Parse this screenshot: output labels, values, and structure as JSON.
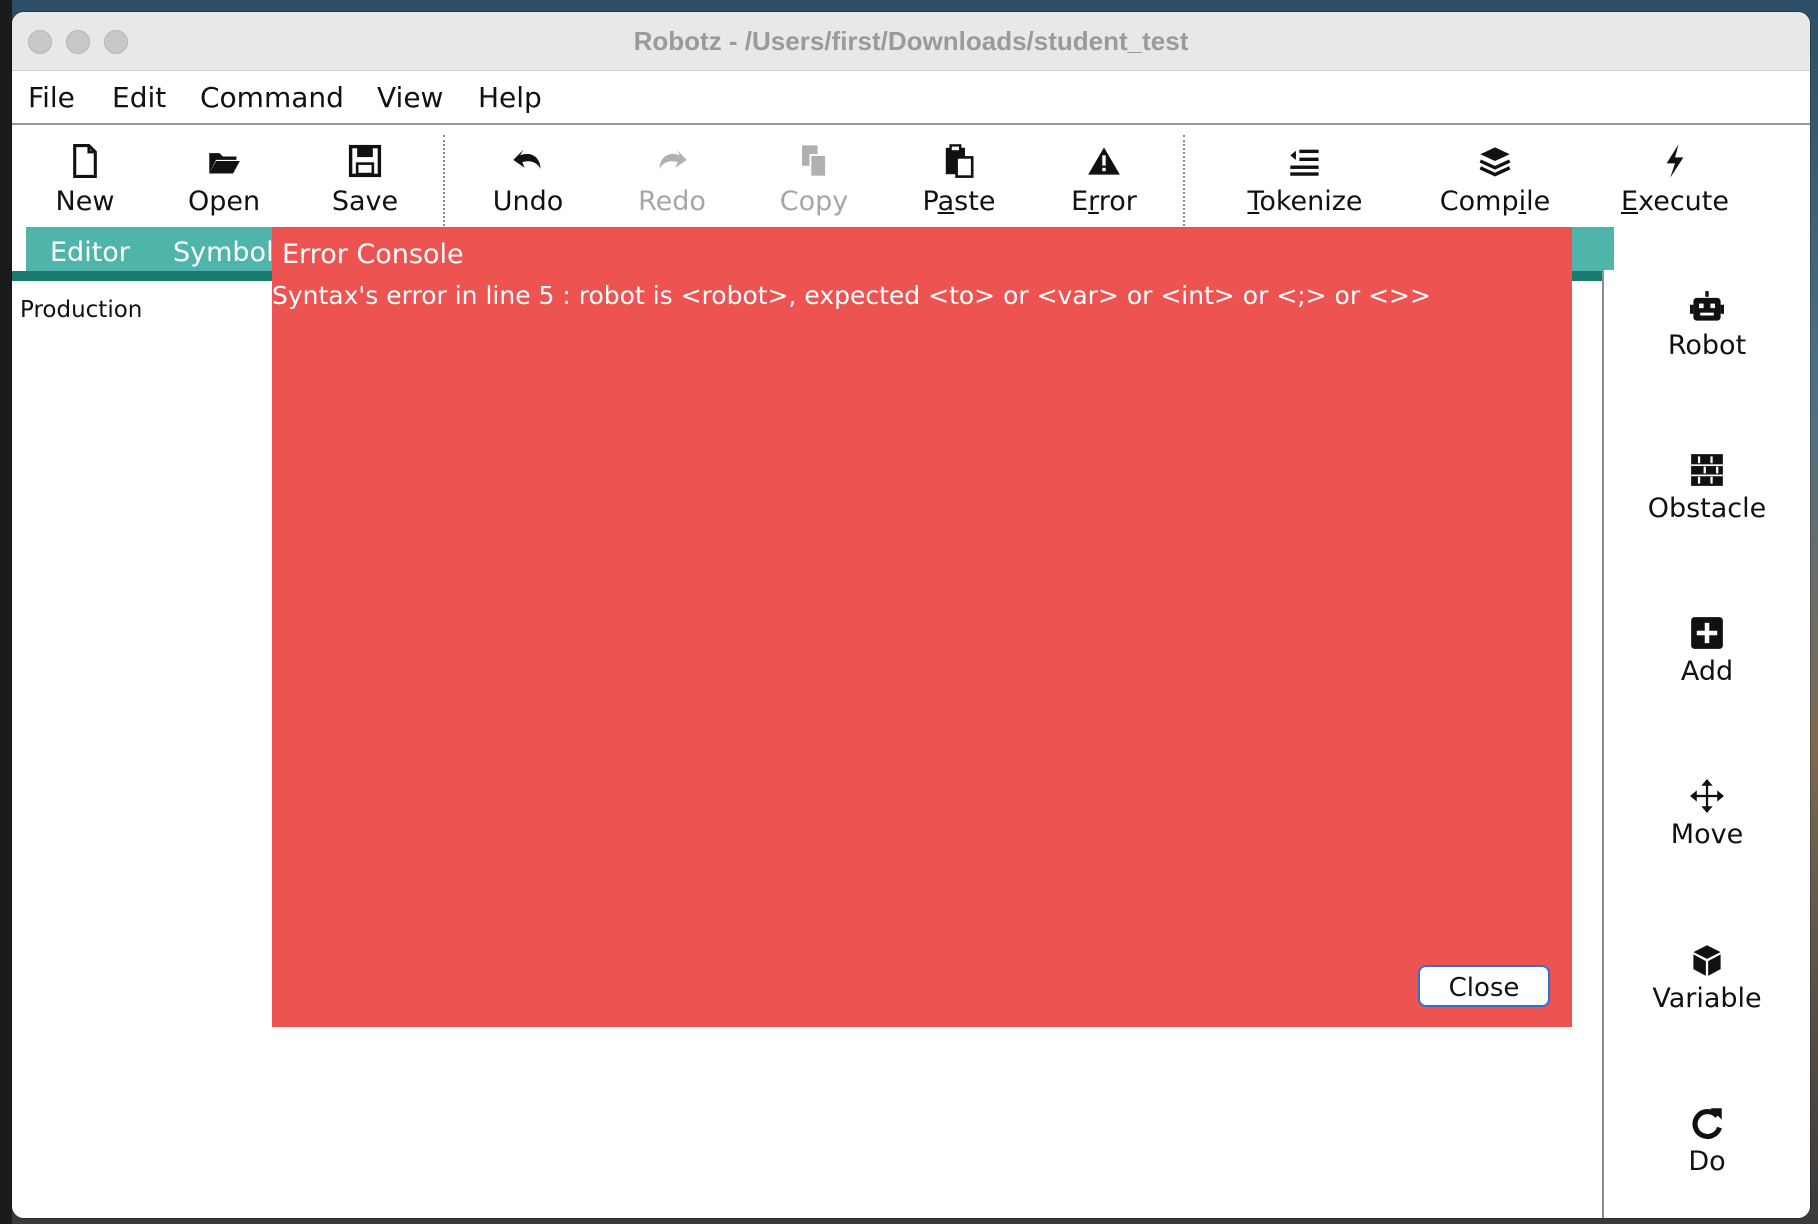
{
  "window": {
    "title": "Robotz - /Users/first/Downloads/student_test"
  },
  "menu": {
    "items": [
      "File",
      "Edit",
      "Command",
      "View",
      "Help"
    ]
  },
  "toolbar": {
    "new": "New",
    "open": "Open",
    "save": "Save",
    "undo": "Undo",
    "redo": "Redo",
    "copy": "Copy",
    "paste": "Paste",
    "error": "Error",
    "tokenize": "Tokenize",
    "compile": "Compile",
    "execute": "Execute"
  },
  "tabs": {
    "editor": "Editor",
    "symbol": "Symbol"
  },
  "editor": {
    "production_label": "Production"
  },
  "sidebar": {
    "robot": "Robot",
    "obstacle": "Obstacle",
    "add": "Add",
    "move": "Move",
    "variable": "Variable",
    "do": "Do"
  },
  "error_console": {
    "title": "Error Console",
    "message": "Syntax's error in line 5 : robot is <robot>, expected <to> or <var> or <int> or <;> or <>>",
    "close_label": "Close"
  },
  "colors": {
    "console_bg": "#ed5451",
    "tab_bg": "#4fb5ab",
    "tab_line": "#1b7a70",
    "close_border": "#2f6fd6"
  }
}
